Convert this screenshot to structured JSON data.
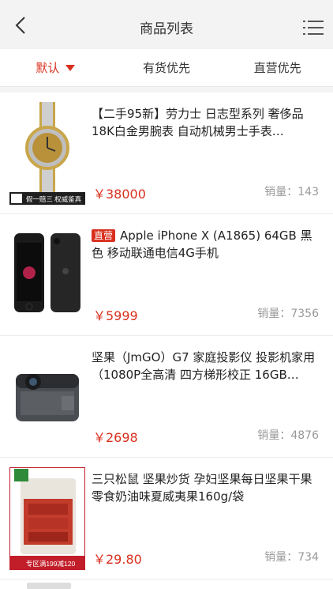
{
  "nav": {
    "title": "商品列表",
    "back_icon": "chevron-left-icon",
    "menu_icon": "list-menu-icon"
  },
  "filters": [
    {
      "label": "默认",
      "active": true
    },
    {
      "label": "有货优先",
      "active": false
    },
    {
      "label": "直营优先",
      "active": false
    }
  ],
  "products": [
    {
      "title": "【二手95新】劳力士 日志型系列 奢侈品18K白金男腕表 自动机械男士手表…",
      "tag": "",
      "price": "￥38000",
      "sales": "销量：143",
      "badge_text": "假一赔三 权威鉴真"
    },
    {
      "title": "Apple iPhone X (A1865) 64GB 黑色 移动联通电信4G手机",
      "tag": "直营",
      "price": "￥5999",
      "sales": "销量：7356"
    },
    {
      "title": "坚果（JmGO）G7 家庭投影仪 投影机家用（1080P全高清 四方梯形校正 16GB…",
      "tag": "",
      "price": "￥2698",
      "sales": "销量：4876"
    },
    {
      "title": "三只松鼠 坚果炒货 孕妇坚果每日坚果干果零食奶油味夏威夷果160g/袋",
      "tag": "",
      "price": "￥29.80",
      "sales": "销量：734",
      "badge_text": "专区满199减120"
    }
  ],
  "colors": {
    "accent": "#d9301e",
    "nav_bg": "#f3f3f3",
    "muted": "#999999"
  }
}
